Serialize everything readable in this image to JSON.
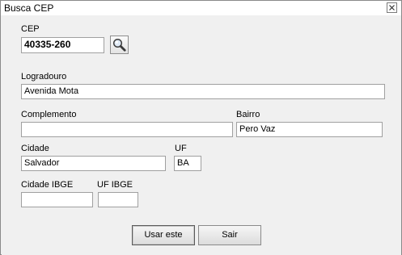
{
  "window": {
    "title": "Busca CEP",
    "close_icon": "close-icon"
  },
  "form": {
    "cep": {
      "label": "CEP",
      "value": "40335-260"
    },
    "search_icon": "search-icon",
    "logradouro": {
      "label": "Logradouro",
      "value": "Avenida Mota"
    },
    "complemento": {
      "label": "Complemento",
      "value": ""
    },
    "bairro": {
      "label": "Bairro",
      "value": "Pero Vaz"
    },
    "cidade": {
      "label": "Cidade",
      "value": "Salvador"
    },
    "uf": {
      "label": "UF",
      "value": "BA"
    },
    "cidade_ibge": {
      "label": "Cidade IBGE",
      "value": ""
    },
    "uf_ibge": {
      "label": "UF IBGE",
      "value": ""
    }
  },
  "buttons": {
    "use": "Usar este",
    "exit": "Sair"
  }
}
